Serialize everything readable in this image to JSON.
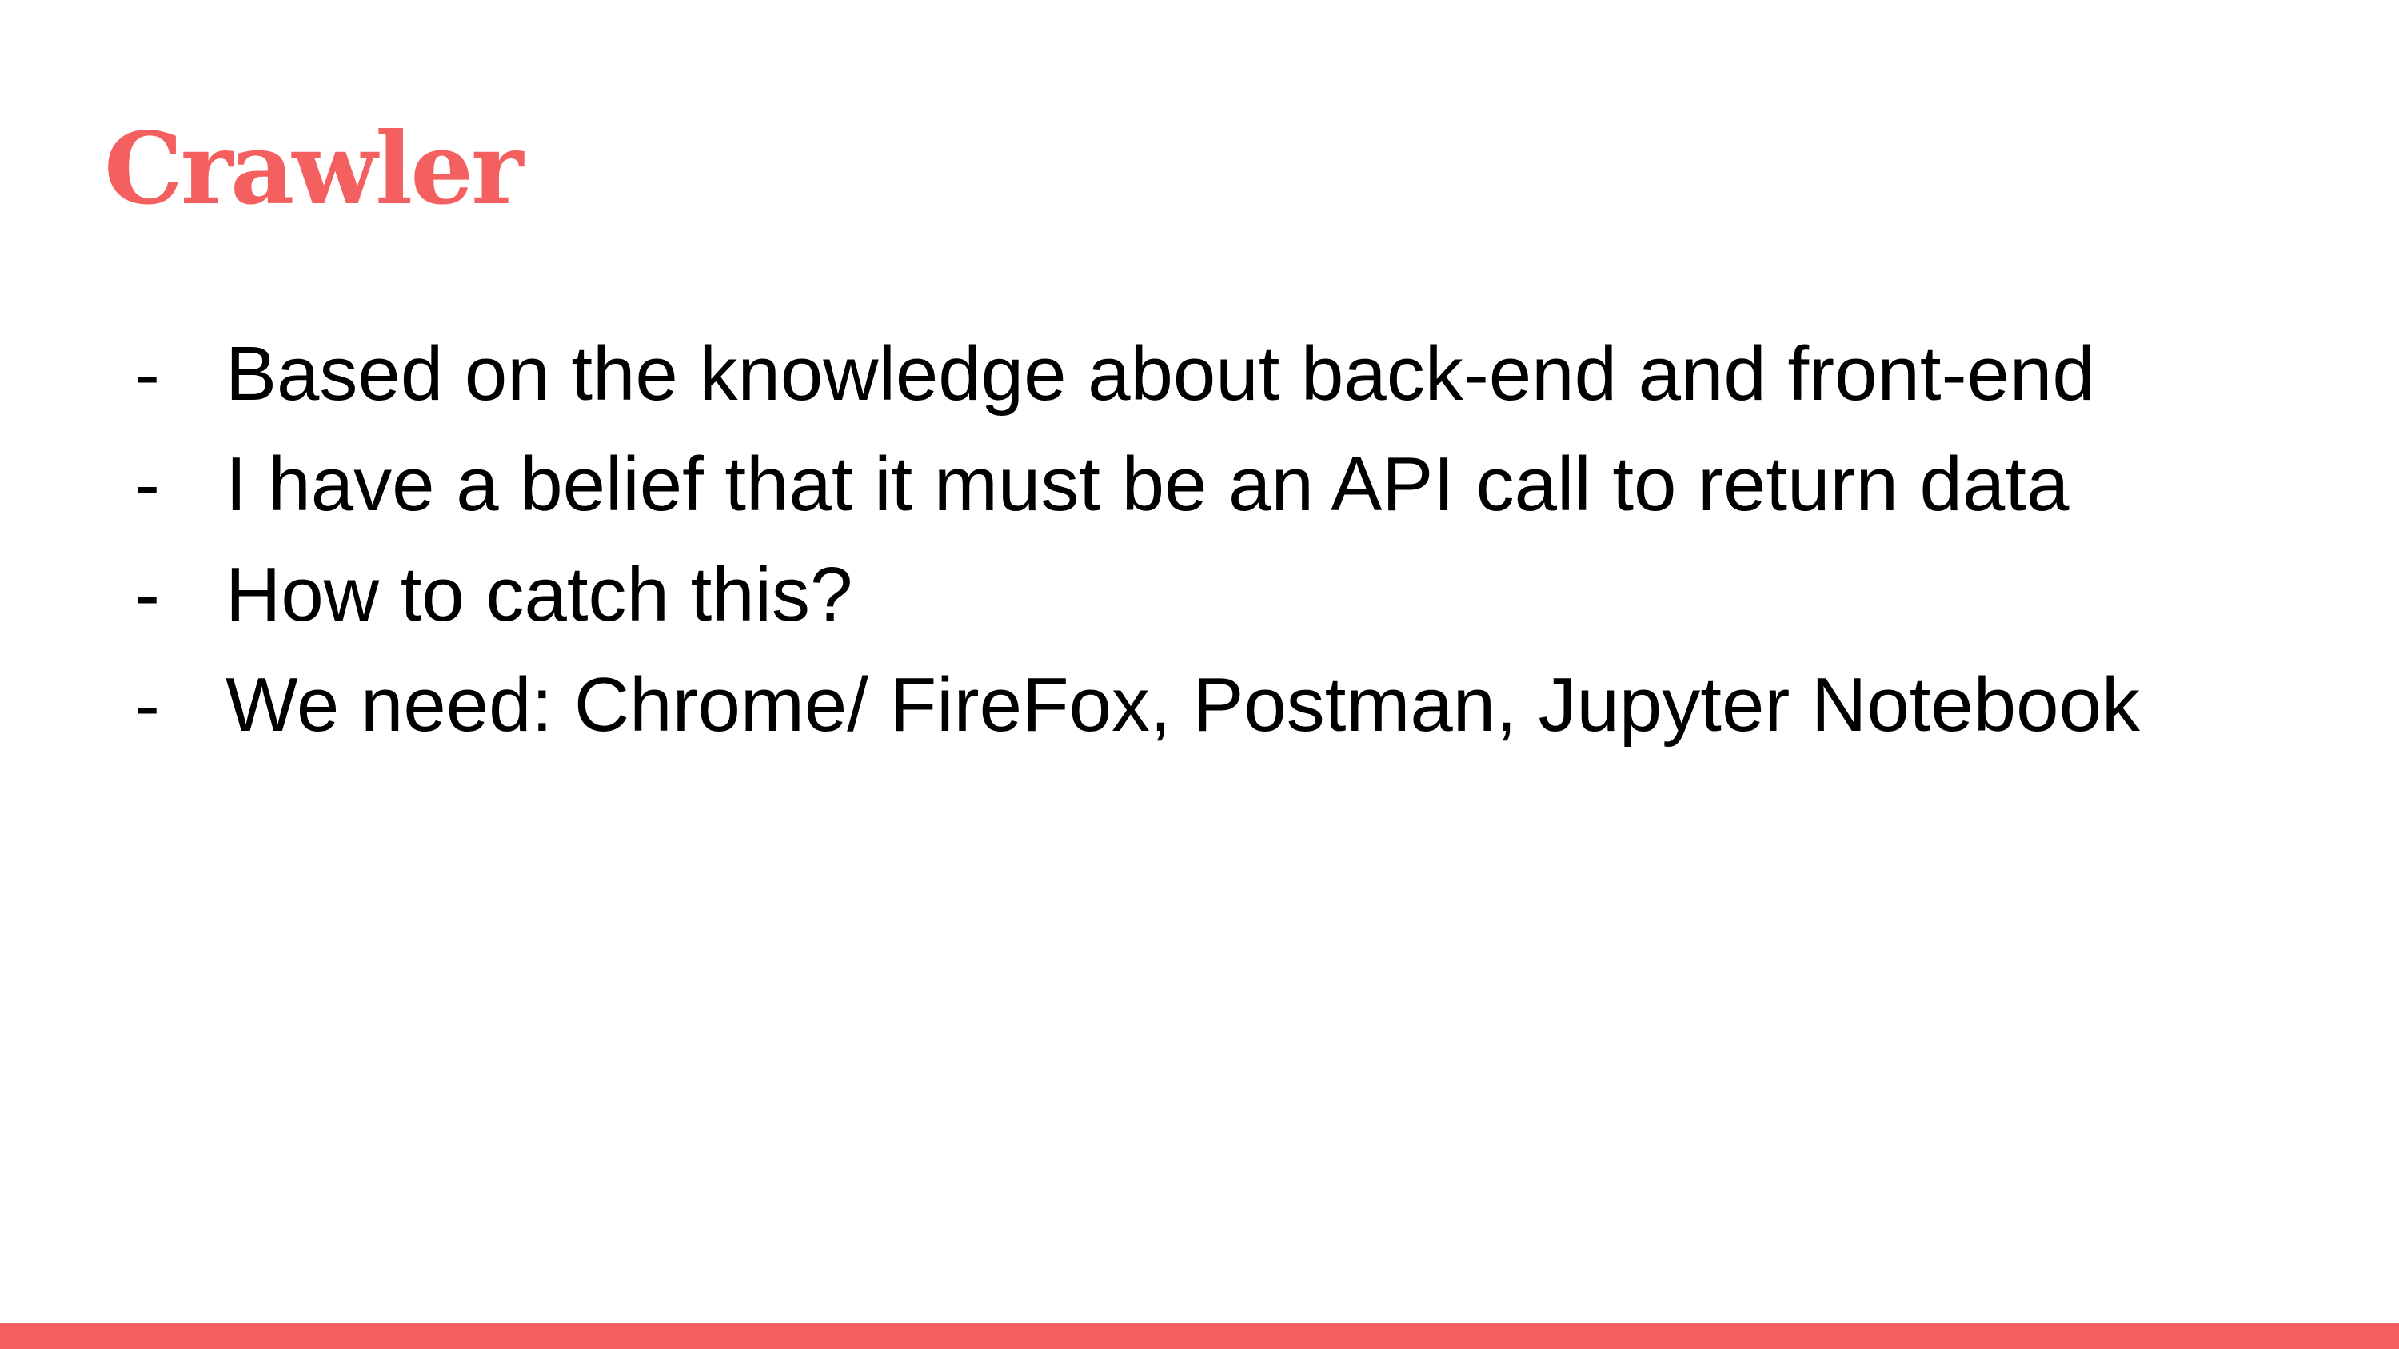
{
  "slide": {
    "title": "Crawler",
    "bullet_marker": "-",
    "bullets": [
      "Based on the knowledge about back-end and front-end",
      "I have a belief that it must be an API call to return data",
      "How to catch this?",
      "We need: Chrome/ FireFox, Postman, Jupyter Notebook"
    ]
  },
  "colors": {
    "accent": "#f46060",
    "text": "#000000",
    "background": "#ffffff"
  }
}
